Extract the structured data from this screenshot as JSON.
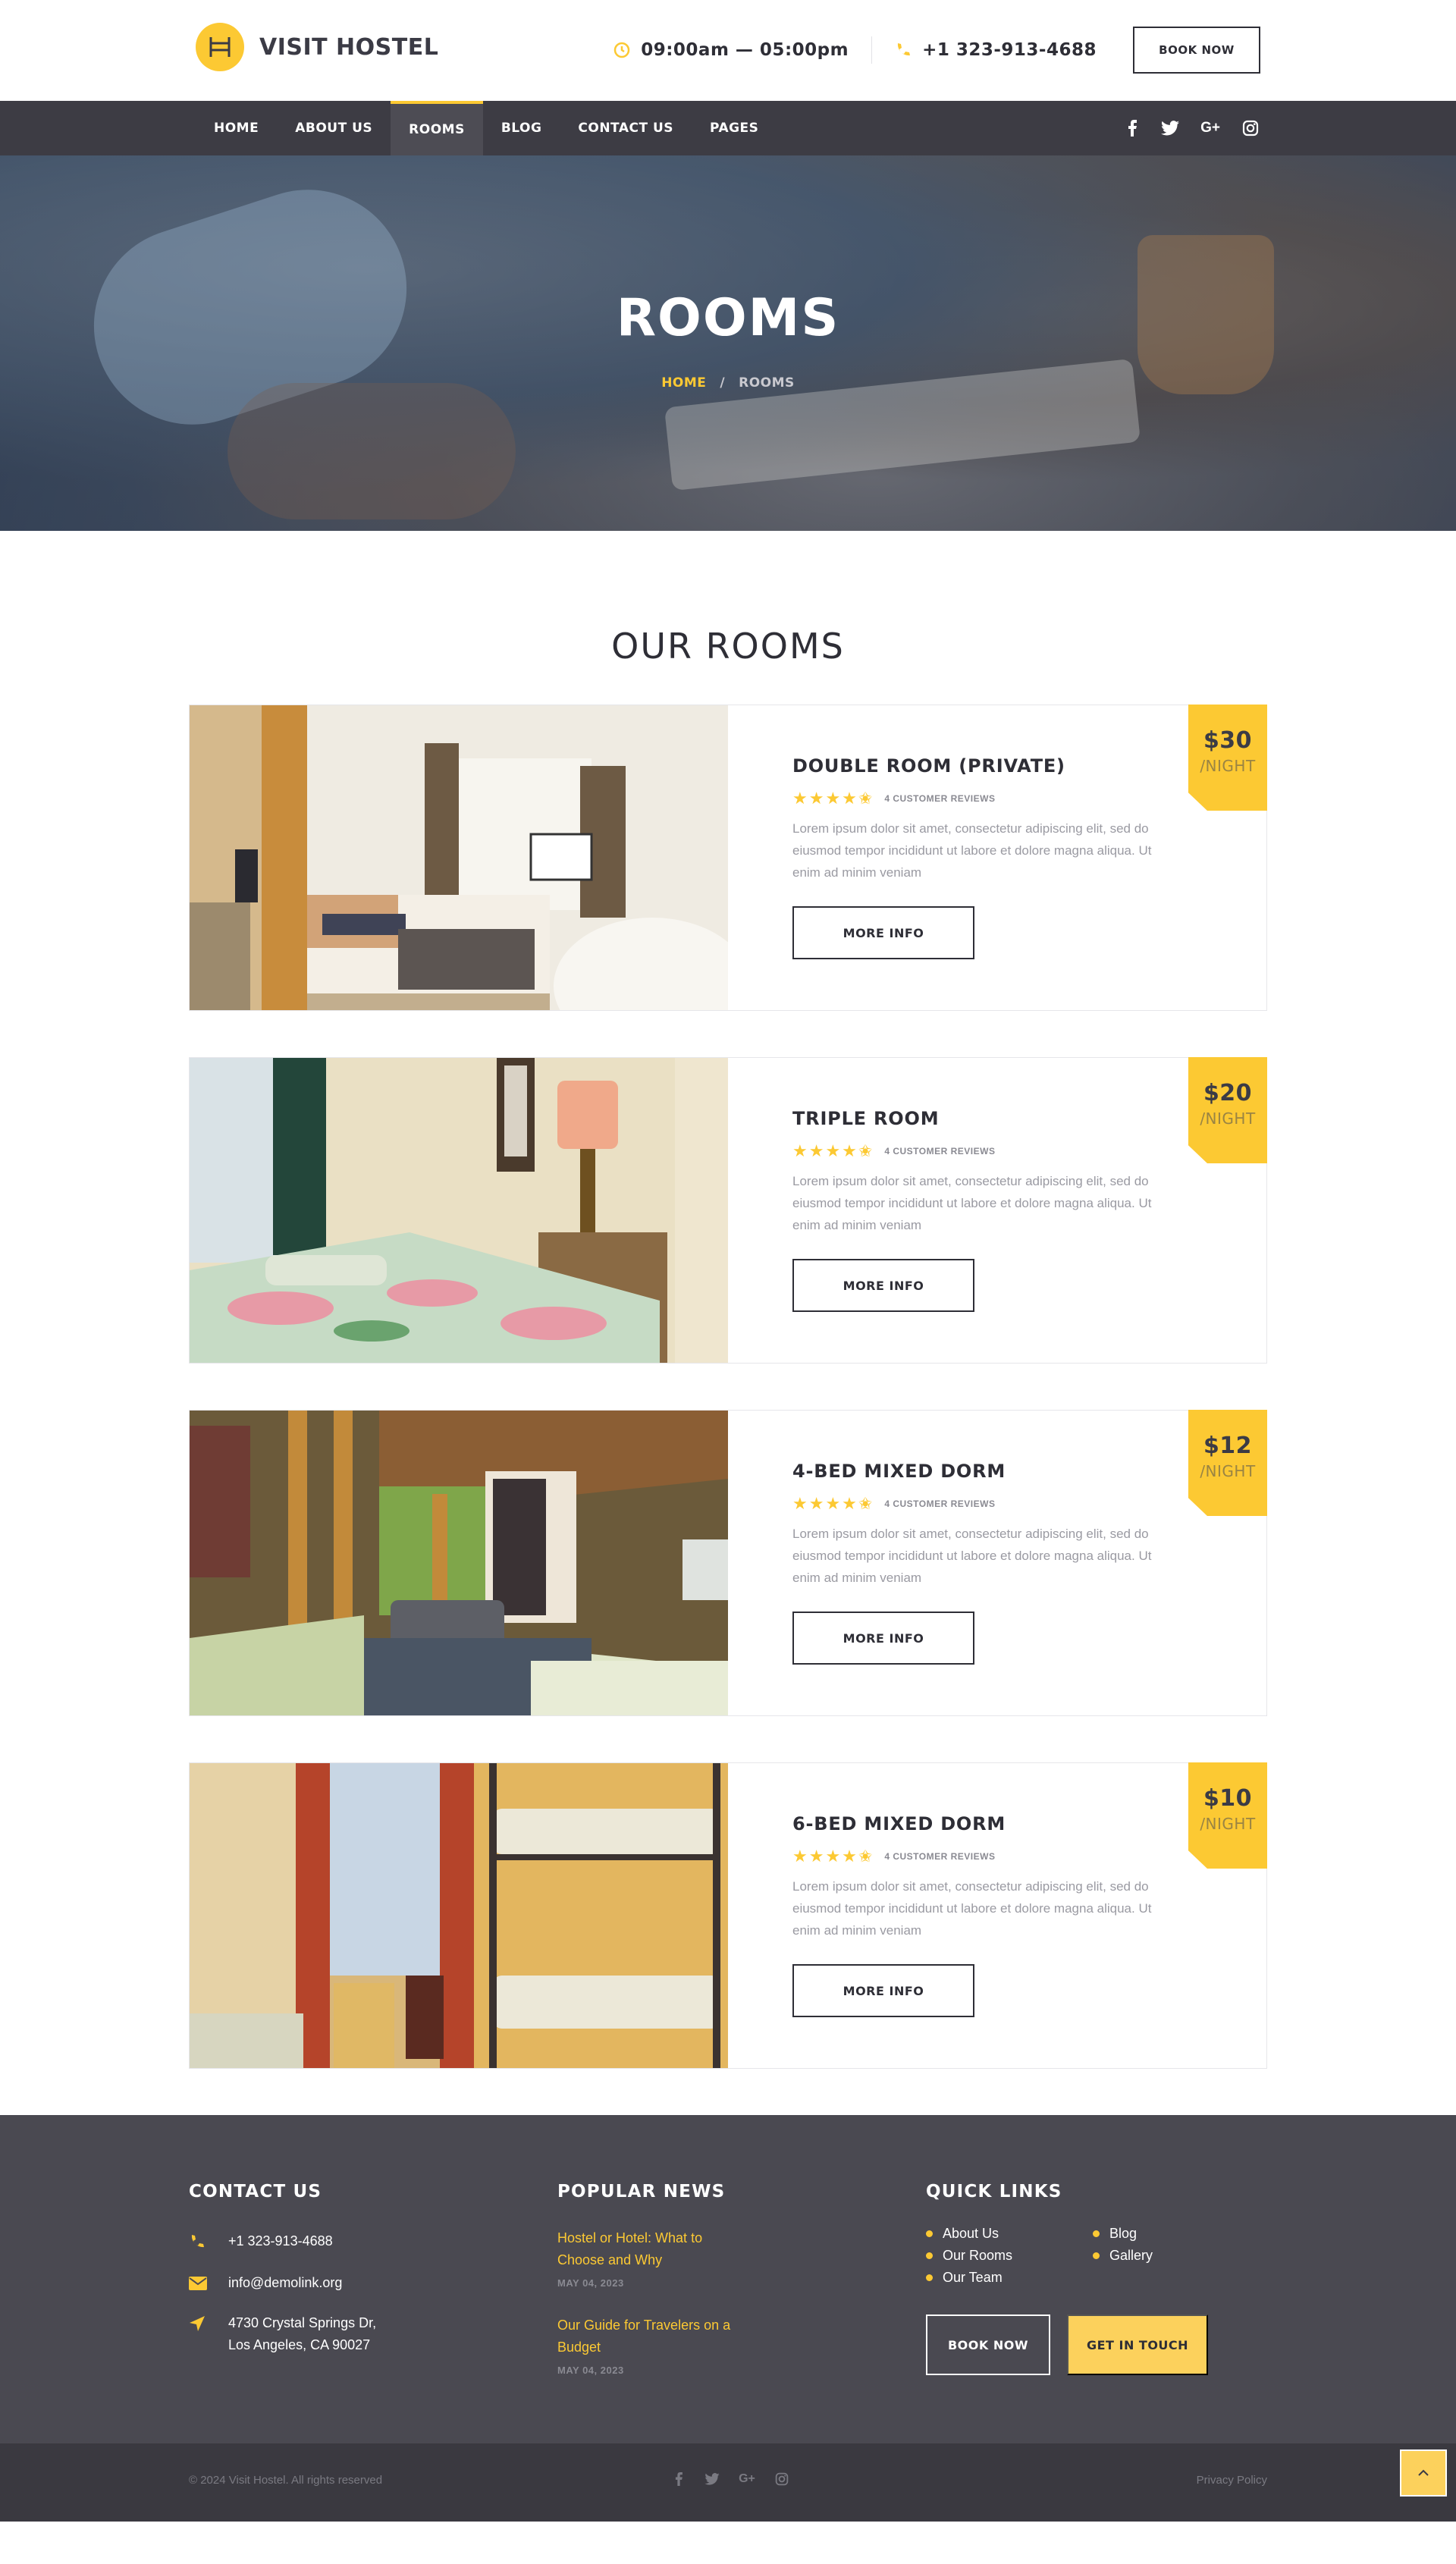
{
  "brand": {
    "name": "VISIT HOSTEL"
  },
  "topbar": {
    "hours": "09:00am — 05:00pm",
    "phone": "+1 323-913-4688",
    "book_label": "BOOK NOW"
  },
  "nav": {
    "items": [
      {
        "label": "HOME"
      },
      {
        "label": "ABOUT US"
      },
      {
        "label": "ROOMS"
      },
      {
        "label": "BLOG"
      },
      {
        "label": "CONTACT US"
      },
      {
        "label": "PAGES"
      }
    ],
    "active": "ROOMS",
    "social": [
      "facebook-icon",
      "twitter-icon",
      "google-plus-icon",
      "instagram-icon"
    ]
  },
  "hero": {
    "title": "ROOMS",
    "breadcrumb_home": "HOME",
    "breadcrumb_sep": "/",
    "breadcrumb_current": "ROOMS"
  },
  "rooms_section": {
    "title": "OUR ROOMS",
    "rooms": [
      {
        "name": "DOUBLE ROOM (PRIVATE)",
        "stars": "★★★★✬",
        "rating": 4.5,
        "reviews": "4 CUSTOMER REVIEWS",
        "desc": "Lorem ipsum dolor sit amet, consectetur adipiscing elit, sed do eiusmod tempor incididunt ut labore et dolore magna aliqua. Ut enim ad minim veniam",
        "button": "MORE INFO",
        "price": "$30",
        "per": "/NIGHT"
      },
      {
        "name": "TRIPLE ROOM",
        "stars": "★★★★✬",
        "rating": 4.5,
        "reviews": "4 CUSTOMER REVIEWS",
        "desc": "Lorem ipsum dolor sit amet, consectetur adipiscing elit, sed do eiusmod tempor incididunt ut labore et dolore magna aliqua. Ut enim ad minim veniam",
        "button": "MORE INFO",
        "price": "$20",
        "per": "/NIGHT"
      },
      {
        "name": "4-BED MIXED DORM",
        "stars": "★★★★✬",
        "rating": 4.5,
        "reviews": "4 CUSTOMER REVIEWS",
        "desc": "Lorem ipsum dolor sit amet, consectetur adipiscing elit, sed do eiusmod tempor incididunt ut labore et dolore magna aliqua. Ut enim ad minim veniam",
        "button": "MORE INFO",
        "price": "$12",
        "per": "/NIGHT"
      },
      {
        "name": "6-BED MIXED DORM",
        "stars": "★★★★✬",
        "rating": 4.5,
        "reviews": "4 CUSTOMER REVIEWS",
        "desc": "Lorem ipsum dolor sit amet, consectetur adipiscing elit, sed do eiusmod tempor incididunt ut labore et dolore magna aliqua. Ut enim ad minim veniam",
        "button": "MORE INFO",
        "price": "$10",
        "per": "/NIGHT"
      }
    ]
  },
  "footer": {
    "contact": {
      "title": "CONTACT US",
      "phone": "+1 323-913-4688",
      "email": "info@demolink.org",
      "address_line1": "4730 Crystal Springs Dr,",
      "address_line2": "Los Angeles, CA 90027"
    },
    "news": {
      "title": "POPULAR NEWS",
      "items": [
        {
          "title": "Hostel or Hotel: What to Choose and Why",
          "date": "MAY 04, 2023"
        },
        {
          "title": "Our Guide for Travelers on a Budget",
          "date": "MAY 04, 2023"
        }
      ]
    },
    "links": {
      "title": "QUICK LINKS",
      "items": [
        "About Us",
        "Blog",
        "Our Rooms",
        "Gallery",
        "Our Team"
      ],
      "book_label": "BOOK NOW",
      "touch_label": "GET IN TOUCH"
    },
    "copyright": "© 2024 Visit Hostel. All rights reserved",
    "privacy": "Privacy Policy"
  },
  "colors": {
    "accent": "#fcc933",
    "dark": "#3d3c44",
    "footer": "#4a4951",
    "footer_bottom": "#3a3940"
  }
}
